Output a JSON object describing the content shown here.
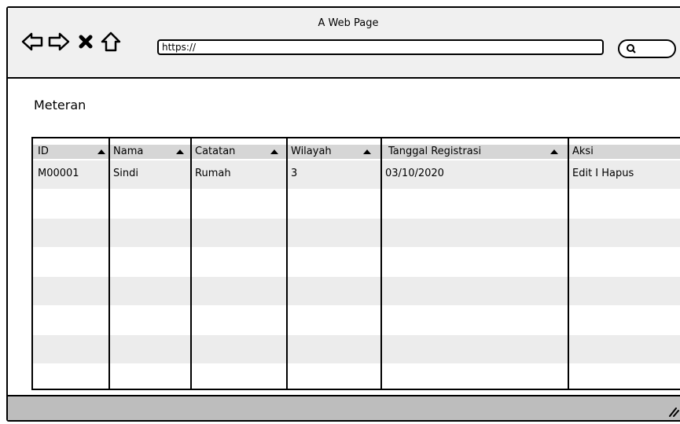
{
  "window": {
    "title": "A Web Page"
  },
  "nav": {
    "back_icon": "arrow-left-icon",
    "forward_icon": "arrow-right-icon",
    "stop_icon": "close-icon",
    "home_icon": "home-icon"
  },
  "address_bar": {
    "value": "https://"
  },
  "search": {
    "icon": "search-icon"
  },
  "page": {
    "title": "Meteran"
  },
  "table": {
    "columns": [
      {
        "label": "ID"
      },
      {
        "label": "Nama"
      },
      {
        "label": "Catatan"
      },
      {
        "label": "Wilayah"
      },
      {
        "label": "Tanggal Registrasi"
      },
      {
        "label": "Aksi"
      }
    ],
    "rows": [
      {
        "id": "M00001",
        "nama": "Sindi",
        "catatan": "Rumah",
        "wilayah": "3",
        "tanggal": "03/10/2020",
        "aksi": "Edit I Hapus"
      }
    ]
  },
  "colors": {
    "chrome": "#f0f0f0",
    "header": "#d6d6d6",
    "stripe": "#ececec",
    "statusbar": "#bdbdbd"
  }
}
